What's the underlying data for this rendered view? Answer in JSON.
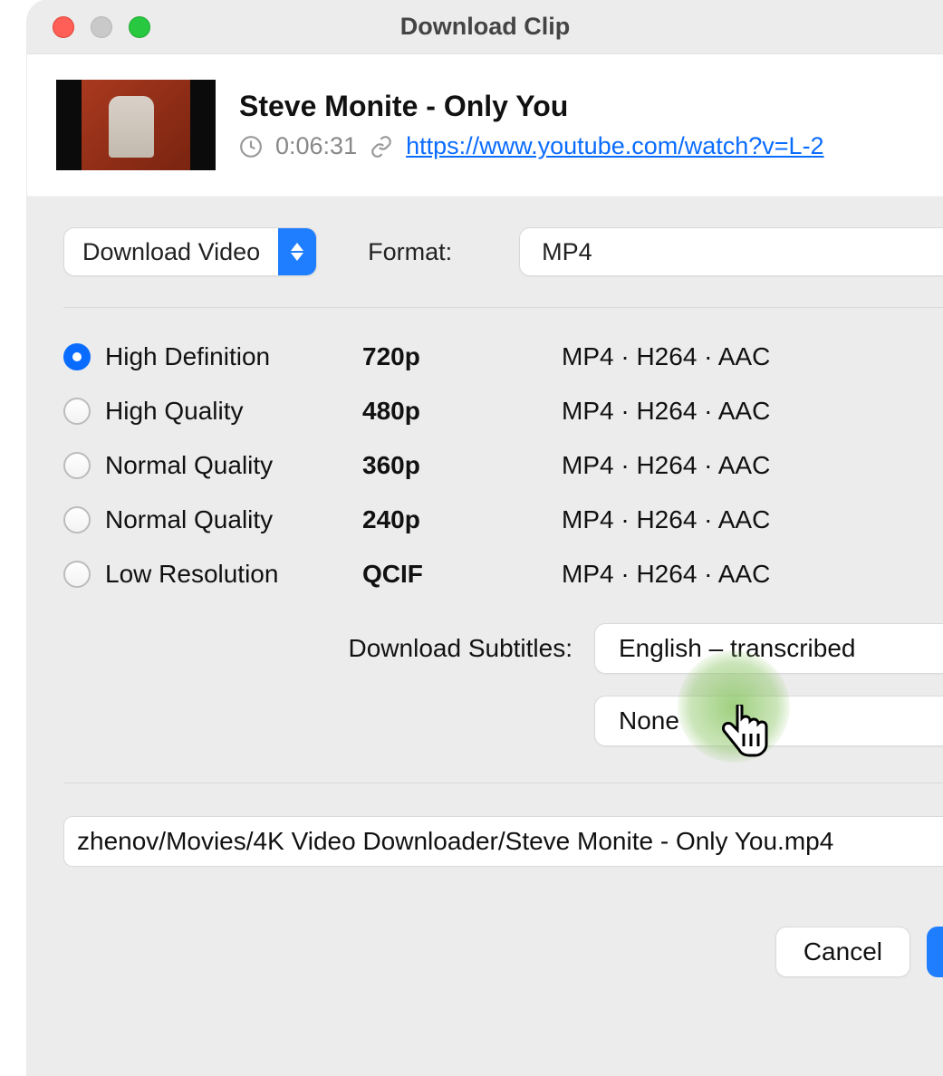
{
  "window": {
    "title": "Download Clip"
  },
  "video": {
    "title": "Steve Monite - Only You",
    "duration": "0:06:31",
    "url": "https://www.youtube.com/watch?v=L-2"
  },
  "action_select": {
    "label": "Download Video"
  },
  "format": {
    "label": "Format:",
    "value": "MP4"
  },
  "qualities": [
    {
      "label": "High Definition",
      "res": "720p",
      "codec": "MP4 · H264 · AAC",
      "selected": true
    },
    {
      "label": "High Quality",
      "res": "480p",
      "codec": "MP4 · H264 · AAC",
      "selected": false
    },
    {
      "label": "Normal Quality",
      "res": "360p",
      "codec": "MP4 · H264 · AAC",
      "selected": false
    },
    {
      "label": "Normal Quality",
      "res": "240p",
      "codec": "MP4 · H264 · AAC",
      "selected": false
    },
    {
      "label": "Low Resolution",
      "res": "QCIF",
      "codec": "MP4 · H264 · AAC",
      "selected": false
    }
  ],
  "subtitles": {
    "label": "Download Subtitles:",
    "option1": "English – transcribed",
    "option2": "None"
  },
  "save_path": "zhenov/Movies/4K Video Downloader/Steve Monite - Only You.mp4",
  "buttons": {
    "cancel": "Cancel"
  }
}
